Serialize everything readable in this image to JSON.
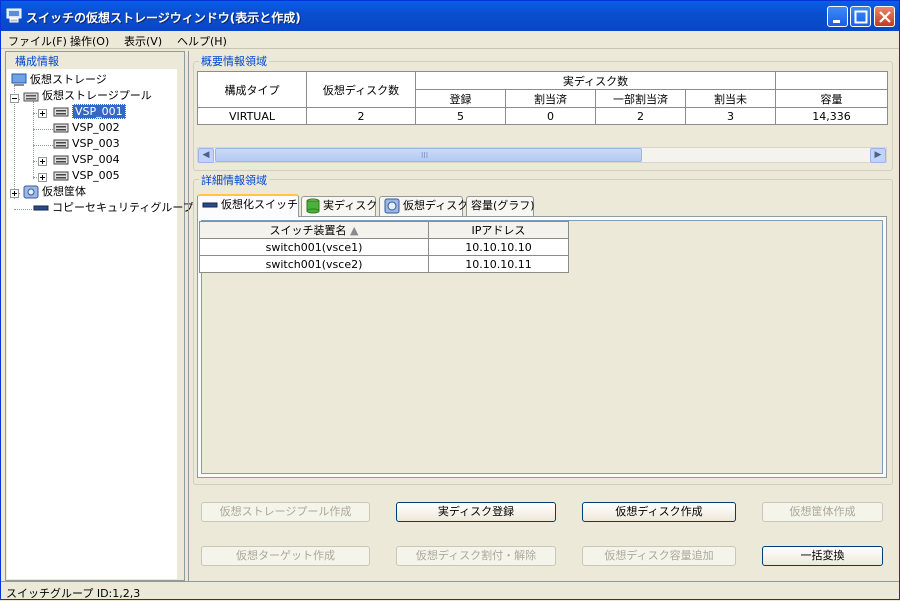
{
  "window": {
    "title": "スイッチの仮想ストレージウィンドウ(表示と作成)"
  },
  "menu": [
    "ファイル(F)",
    "操作(O)",
    "表示(V)",
    "ヘルプ(H)"
  ],
  "left": {
    "label": "構成情報",
    "tree": {
      "root": "仮想ストレージ",
      "pool": "仮想ストレージプール",
      "vsps": [
        "VSP_001",
        "VSP_002",
        "VSP_003",
        "VSP_004",
        "VSP_005"
      ],
      "enclosure": "仮想筐体",
      "copy_group": "コピーセキュリティグループ"
    }
  },
  "summary": {
    "label": "概要情報領域",
    "headers": {
      "config_type": "構成タイプ",
      "vdisk_count": "仮想ディスク数",
      "real_disk_group": "実ディスク数",
      "registered": "登録",
      "assigned": "割当済",
      "partially_assigned": "一部割当済",
      "unassigned": "割当未",
      "capacity": "容量"
    },
    "row": {
      "config_type": "VIRTUAL",
      "vdisk_count": "2",
      "registered": "5",
      "assigned": "0",
      "partially_assigned": "2",
      "unassigned": "3",
      "capacity": "14,336"
    },
    "scroll_grip": "III"
  },
  "detail": {
    "label": "詳細情報領域",
    "tabs": [
      "仮想化スイッチ",
      "実ディスク",
      "仮想ディスク",
      "容量(グラフ)"
    ],
    "active_tab": 0,
    "columns": [
      "スイッチ装置名",
      "IPアドレス"
    ],
    "sort_indicator": "▲",
    "rows": [
      {
        "name": "switch001(vsce1)",
        "ip": "10.10.10.10"
      },
      {
        "name": "switch001(vsce2)",
        "ip": "10.10.10.11"
      }
    ]
  },
  "buttons": {
    "create_pool": "仮想ストレージプール作成",
    "register_disk": "実ディスク登録",
    "create_vdisk": "仮想ディスク作成",
    "create_enclosure": "仮想筐体作成",
    "create_target": "仮想ターゲット作成",
    "assign_vdisk": "仮想ディスク割付・解除",
    "add_capacity": "仮想ディスク容量追加",
    "batch_convert": "一括変換"
  },
  "status": {
    "text": "スイッチグループ ID:1,2,3"
  },
  "colors": {
    "title_bar": "#0a4fd0",
    "selection": "#316ac5",
    "group_label": "#0046d5",
    "active_tab_accent": "#ffc83c"
  }
}
